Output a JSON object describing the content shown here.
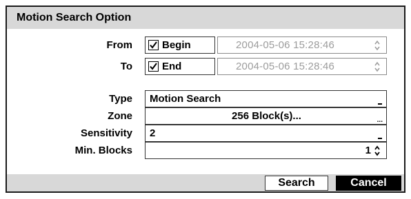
{
  "dialog": {
    "title": "Motion Search Option"
  },
  "from": {
    "label": "From",
    "checkbox_label": "Begin",
    "checked": true,
    "datetime": "2004-05-06  15:28:46"
  },
  "to": {
    "label": "To",
    "checkbox_label": "End",
    "checked": true,
    "datetime": "2004-05-06  15:28:46"
  },
  "type": {
    "label": "Type",
    "value": "Motion Search"
  },
  "zone": {
    "label": "Zone",
    "value": "256 Block(s)..."
  },
  "sensitivity": {
    "label": "Sensitivity",
    "value": "2"
  },
  "min_blocks": {
    "label": "Min. Blocks",
    "value": "1"
  },
  "buttons": {
    "search": "Search",
    "cancel": "Cancel"
  },
  "icons": {
    "checkbox": "checkmark-icon",
    "spinner": "up-down-spinner-icon",
    "dropdown": "dropdown-indicator-icon"
  },
  "colors": {
    "panel_gray": "#d8d8d8",
    "disabled_text": "#9c9c9c",
    "cancel_bg": "#000000"
  }
}
